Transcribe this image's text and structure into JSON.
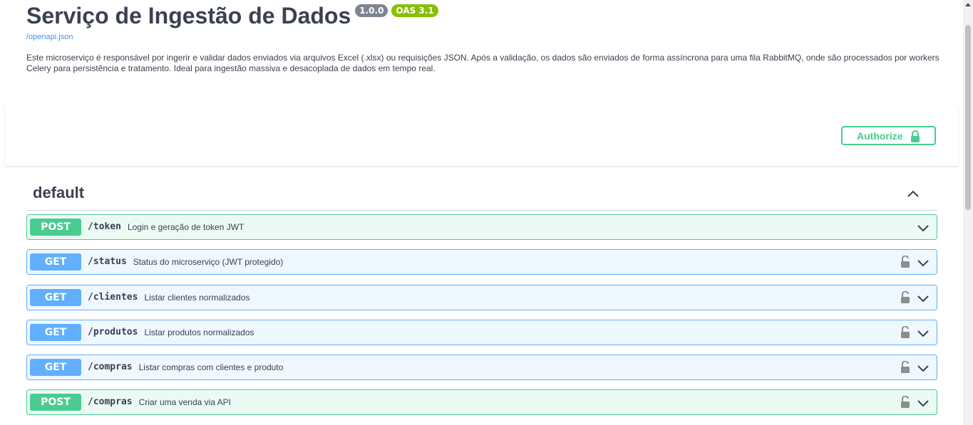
{
  "info": {
    "title": "Serviço de Ingestão de Dados",
    "version": "1.0.0",
    "oas": "OAS 3.1",
    "spec_link": "/openapi.json",
    "description": "Este microserviço é responsável por ingerir e validar dados enviados via arquivos Excel (.xlsx) ou requisições JSON. Após a validação, os dados são enviados de forma assíncrona para uma fila RabbitMQ, onde são processados por workers Celery para persistência e tratamento. Ideal para ingestão massiva e desacoplada de dados em tempo real."
  },
  "auth": {
    "label": "Authorize"
  },
  "tag": {
    "name": "default",
    "expanded": true
  },
  "operations": [
    {
      "method": "POST",
      "path": "/token",
      "summary": "Login e geração de token JWT",
      "locked": false
    },
    {
      "method": "GET",
      "path": "/status",
      "summary": "Status do microserviço (JWT protegido)",
      "locked": true
    },
    {
      "method": "GET",
      "path": "/clientes",
      "summary": "Listar clientes normalizados",
      "locked": true
    },
    {
      "method": "GET",
      "path": "/produtos",
      "summary": "Listar produtos normalizados",
      "locked": true
    },
    {
      "method": "GET",
      "path": "/compras",
      "summary": "Listar compras com clientes e produto",
      "locked": true
    },
    {
      "method": "POST",
      "path": "/compras",
      "summary": "Criar uma venda via API",
      "locked": true
    }
  ],
  "colors": {
    "post": "#49cc90",
    "get": "#61affe",
    "text": "#3b4151",
    "link": "#4990e2"
  }
}
